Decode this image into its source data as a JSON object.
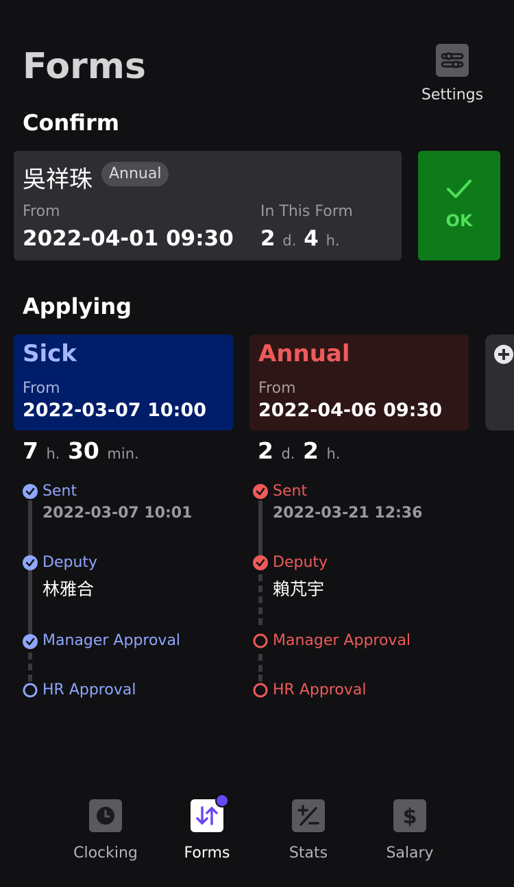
{
  "page": {
    "title": "Forms"
  },
  "settings": {
    "label": "Settings",
    "icon": "sliders-icon"
  },
  "confirm": {
    "heading": "Confirm",
    "card": {
      "name": "吳祥珠",
      "tag": "Annual",
      "from_label": "From",
      "from_value": "2022-04-01  09:30",
      "in_form_label": "In This Form",
      "days": "2",
      "days_unit": "d.",
      "hours": "4",
      "hours_unit": "h."
    },
    "ok_button": {
      "label": "OK",
      "icon": "check-icon",
      "color": "#0e7a19"
    }
  },
  "applying": {
    "heading": "Applying",
    "forms": [
      {
        "type": "Sick",
        "from_label": "From",
        "from_value": "2022-03-07  10:00",
        "duration": [
          {
            "value": "7",
            "unit": "h."
          },
          {
            "value": "30",
            "unit": "min."
          }
        ],
        "accent": "#8fa6ff",
        "timeline": [
          {
            "label": "Sent",
            "detail": "2022-03-07 10:01",
            "done": true
          },
          {
            "label": "Deputy",
            "detail": "林雅合",
            "done": true
          },
          {
            "label": "Manager Approval",
            "detail": "",
            "done": true
          },
          {
            "label": "HR Approval",
            "detail": "",
            "done": false
          }
        ]
      },
      {
        "type": "Annual",
        "from_label": "From",
        "from_value": "2022-04-06  09:30",
        "duration": [
          {
            "value": "2",
            "unit": "d."
          },
          {
            "value": "2",
            "unit": "h."
          }
        ],
        "accent": "#ef5a5a",
        "timeline": [
          {
            "label": "Sent",
            "detail": "2022-03-21 12:36",
            "done": true
          },
          {
            "label": "Deputy",
            "detail": "賴芃宇",
            "done": true
          },
          {
            "label": "Manager Approval",
            "detail": "",
            "done": false
          },
          {
            "label": "HR Approval",
            "detail": "",
            "done": false
          }
        ]
      }
    ],
    "add_button": {
      "icon": "plus-circle-icon"
    }
  },
  "tabbar": {
    "tabs": [
      {
        "label": "Clocking",
        "icon": "clock-icon",
        "active": false
      },
      {
        "label": "Forms",
        "icon": "swap-arrows-icon",
        "active": true,
        "badge": true
      },
      {
        "label": "Stats",
        "icon": "plus-minus-icon",
        "active": false
      },
      {
        "label": "Salary",
        "icon": "dollar-icon",
        "active": false
      }
    ]
  }
}
